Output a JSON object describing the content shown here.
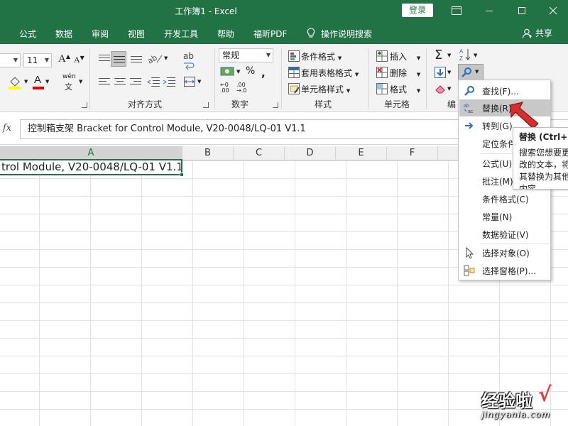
{
  "window": {
    "title": "工作簿1  -  Excel",
    "login_label": "登录"
  },
  "menu": {
    "items": [
      "公式",
      "数据",
      "审阅",
      "视图",
      "开发工具",
      "帮助",
      "福昕PDF"
    ],
    "tell_me": "操作说明搜索",
    "share": "共享"
  },
  "ribbon": {
    "font_size": "11",
    "number_format": "常规",
    "number_percent": "%",
    "groups": {
      "alignment": "对齐方式",
      "number": "数字",
      "styles": "样式",
      "cells": "单元格",
      "editing": "编"
    },
    "styles": {
      "conditional": "条件格式",
      "table": "套用表格格式",
      "cell_styles": "单元格样式"
    },
    "cells": {
      "insert": "插入",
      "delete": "删除",
      "format": "格式"
    },
    "phonetic": "wén"
  },
  "formula_bar": {
    "fx_label": "fx",
    "content": "控制箱支架 Bracket for Control Module, V20-0048/LQ-01 V1.1"
  },
  "grid": {
    "columns": [
      "A",
      "B",
      "C",
      "D",
      "E",
      "F"
    ],
    "active_cell_text": "trol Module, V20-0048/LQ-01 V1.1"
  },
  "find_menu": {
    "items": [
      {
        "label": "查找(F)...",
        "icon": "magnifier-icon"
      },
      {
        "label": "替换(R)...",
        "icon": "replace-abc-icon"
      },
      {
        "label": "转到(G)...",
        "icon": "arrow-right-icon"
      },
      {
        "label": "定位条件(S)...",
        "icon": ""
      },
      {
        "label": "公式(U)",
        "icon": ""
      },
      {
        "label": "批注(M)",
        "icon": ""
      },
      {
        "label": "条件格式(C)",
        "icon": ""
      },
      {
        "label": "常量(N)",
        "icon": ""
      },
      {
        "label": "数据验证(V)",
        "icon": ""
      },
      {
        "label": "选择对象(O)",
        "icon": "cursor-arrow-icon"
      },
      {
        "label": "选择窗格(P)...",
        "icon": "selection-pane-icon"
      }
    ]
  },
  "tooltip": {
    "title": "替换 (Ctrl+H)",
    "description": "搜索您想要更改的文本，将其替换为其他内容。"
  },
  "watermark": {
    "main": "经验啦",
    "sub": "jingyanla.com",
    "check": "√"
  },
  "colors": {
    "excel_green": "#217346",
    "red_arrow": "#d32f2f"
  }
}
